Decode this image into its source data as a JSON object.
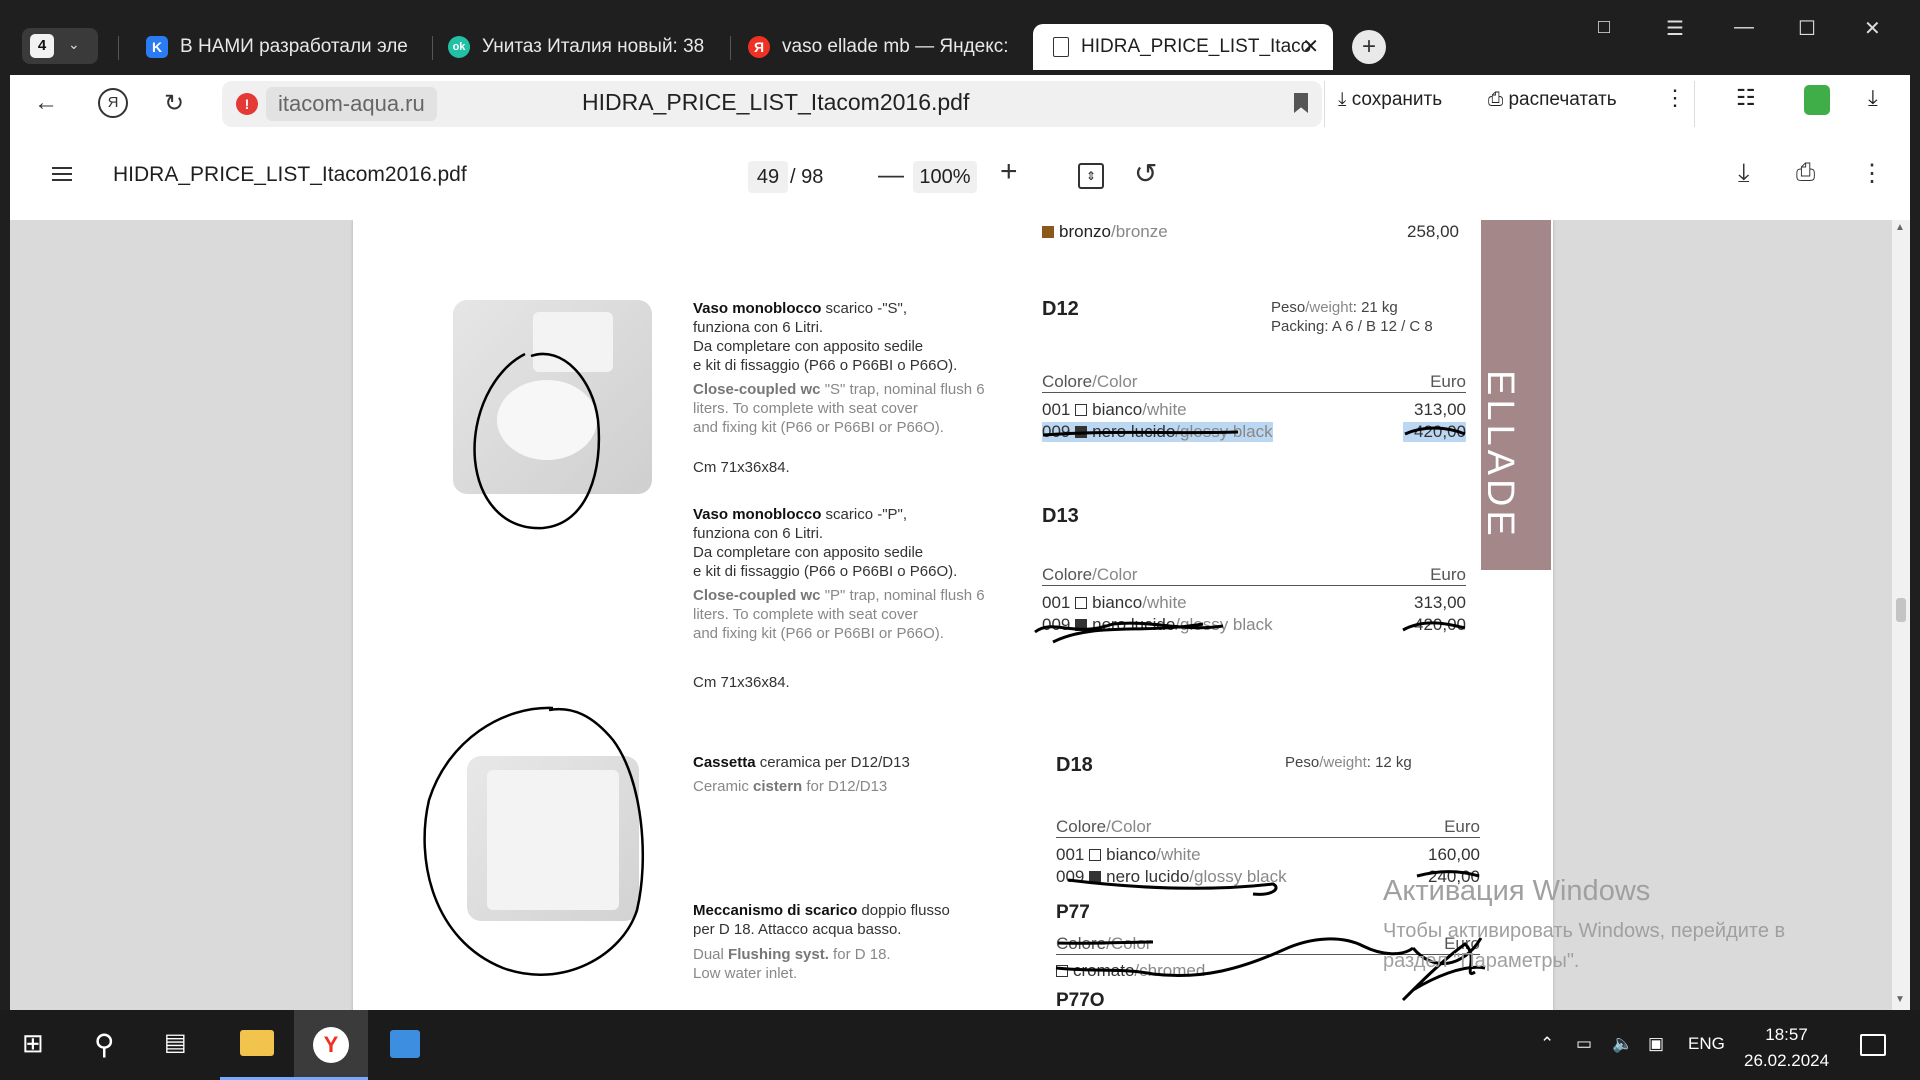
{
  "browser": {
    "tab_count": "4",
    "tabs": [
      {
        "title": "В НАМИ разработали эле",
        "favicon": "K",
        "favicon_color": "#2b7bf2"
      },
      {
        "title": "Унитаз Италия новый: 38",
        "favicon": "ok",
        "favicon_color": "#22c1a6"
      },
      {
        "title": "vaso ellade mb — Яндекс:",
        "favicon": "Я",
        "favicon_color": "#ef3124"
      },
      {
        "title": "HIDRA_PRICE_LIST_Itaco",
        "favicon": "doc-icon",
        "favicon_color": "#ffffff"
      }
    ],
    "domain": "itacom-aqua.ru",
    "omni_title": "HIDRA_PRICE_LIST_Itacom2016.pdf",
    "save_label": "сохранить",
    "print_label": "распечатать"
  },
  "pdf": {
    "title": "HIDRA_PRICE_LIST_Itacom2016.pdf",
    "current_page": "49",
    "total_pages": "/ 98",
    "zoom": "100%"
  },
  "content": {
    "side_label": "ELLADE",
    "top_row": {
      "color_it": "bronzo",
      "color_en": "/bronze",
      "price": "258,00"
    },
    "d12": {
      "desc_it_bold": "Vaso monoblocco",
      "desc_it_rest": " scarico -\"S\",",
      "desc_it_lines": [
        "funziona con 6 Litri.",
        "Da completare con apposito sedile",
        "e kit di fissaggio (P66 o P66BI o P66O)."
      ],
      "desc_en_bold": "Close-coupled wc",
      "desc_en_rest": " \"S\" trap, nominal flush 6",
      "desc_en_lines": [
        "liters. To complete with seat cover",
        "and fixing kit (P66 or P66BI or P66O)."
      ],
      "dims": "Cm 71x36x84.",
      "code": "D12",
      "weight_label": "Peso",
      "weight_label_en": "/weight",
      "weight_value": ": 21 kg",
      "packing": "Packing:  A 6 / B 12 / C 8",
      "header_left_it": "Colore",
      "header_left_en": "/Color",
      "header_right": "Euro",
      "row1_code": "001",
      "row1_it": "bianco",
      "row1_en": "/white",
      "row1_price": "313,00",
      "row2_code": "009",
      "row2_it": "nero lucido",
      "row2_en": "/glossy black",
      "row2_price": "420,00"
    },
    "d13": {
      "desc_it_bold": "Vaso monoblocco",
      "desc_it_rest": " scarico -\"P\",",
      "desc_it_lines": [
        "funziona con 6 Litri.",
        "Da completare con apposito sedile",
        "e kit di fissaggio (P66 o P66BI o P66O)."
      ],
      "desc_en_bold": "Close-coupled wc",
      "desc_en_rest": " \"P\" trap, nominal flush 6",
      "desc_en_lines": [
        "liters. To complete with seat cover",
        "and fixing kit (P66 or P66BI or P66O)."
      ],
      "dims": "Cm 71x36x84.",
      "code": "D13",
      "header_left_it": "Colore",
      "header_left_en": "/Color",
      "header_right": "Euro",
      "row1_code": "001",
      "row1_it": "bianco",
      "row1_en": "/white",
      "row1_price": "313,00",
      "row2_code": "009",
      "row2_it": "nero lucido",
      "row2_en": "/glossy black",
      "row2_price": "420,00"
    },
    "d18": {
      "desc_it_bold": "Cassetta",
      "desc_it_rest": " ceramica per D12/D13",
      "desc_en_pre": "Ceramic ",
      "desc_en_bold": "cistern",
      "desc_en_rest": " for D12/D13",
      "code": "D18",
      "weight_label": "Peso",
      "weight_label_en": "/weight",
      "weight_value": ": 12 kg",
      "header_left_it": "Colore",
      "header_left_en": "/Color",
      "header_right": "Euro",
      "row1_code": "001",
      "row1_it": "bianco",
      "row1_en": "/white",
      "row1_price": "160,00",
      "row2_code": "009",
      "row2_it": "nero lucido",
      "row2_en": "/glossy black",
      "row2_price": "240,00"
    },
    "p77": {
      "desc_it_bold": "Meccanismo di scarico",
      "desc_it_rest": " doppio flusso",
      "desc_it_line2": "per D 18. Attacco acqua basso.",
      "desc_en_pre": "Dual ",
      "desc_en_bold": "Flushing syst.",
      "desc_en_rest": " for D 18.",
      "desc_en_line2": "Low water inlet.",
      "code": "P77",
      "header_left_it": "Colore",
      "header_left_en": "/Color",
      "header_right": "Euro",
      "row1_it": "cromato",
      "row1_en": "/chromed",
      "code2": "P77O"
    }
  },
  "watermark": {
    "line1": "Активация Windows",
    "line2": "Чтобы активировать Windows, перейдите в",
    "line3": "раздел \"Параметры\"."
  },
  "taskbar": {
    "lang": "ENG",
    "time": "18:57",
    "date": "26.02.2024"
  },
  "colors": {
    "band": "#a38789",
    "bronze_swatch": "#8a5a1c",
    "marker": "#000000"
  }
}
